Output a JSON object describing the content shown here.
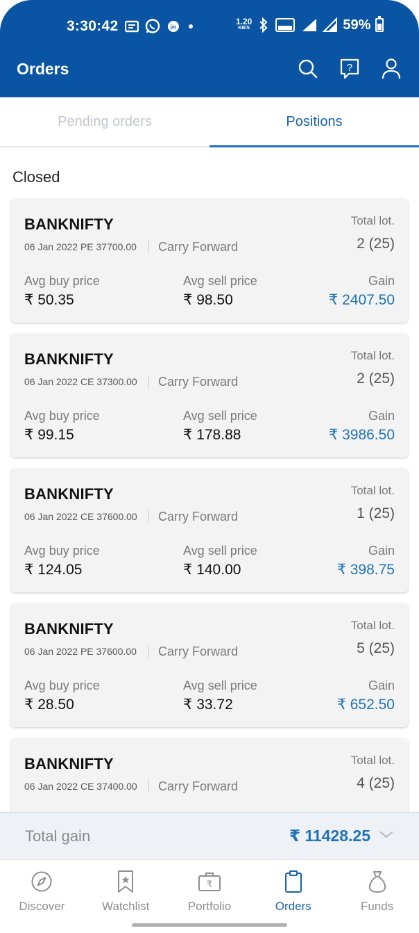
{
  "status_bar": {
    "time": "3:30:42",
    "net_speed_value": "1.20",
    "net_speed_unit": "KB/S",
    "battery": "59%"
  },
  "header": {
    "title": "Orders",
    "icons": [
      "search-icon",
      "help-chat-icon",
      "profile-icon"
    ]
  },
  "tabs": [
    {
      "label": "Pending orders",
      "active": false
    },
    {
      "label": "Positions",
      "active": true
    }
  ],
  "section_title": "Closed",
  "columns": {
    "total_lot": "Total lot.",
    "avg_buy": "Avg buy price",
    "avg_sell": "Avg sell price",
    "gain": "Gain"
  },
  "positions": [
    {
      "symbol": "BANKNIFTY",
      "contract": "06 Jan 2022 PE 37700.00",
      "product": "Carry Forward",
      "lots": "2 (25)",
      "avg_buy": "₹ 50.35",
      "avg_sell": "₹ 98.50",
      "gain": "₹ 2407.50"
    },
    {
      "symbol": "BANKNIFTY",
      "contract": "06 Jan 2022 CE 37300.00",
      "product": "Carry Forward",
      "lots": "2 (25)",
      "avg_buy": "₹ 99.15",
      "avg_sell": "₹ 178.88",
      "gain": "₹ 3986.50"
    },
    {
      "symbol": "BANKNIFTY",
      "contract": "06 Jan 2022 CE 37600.00",
      "product": "Carry Forward",
      "lots": "1 (25)",
      "avg_buy": "₹ 124.05",
      "avg_sell": "₹ 140.00",
      "gain": "₹ 398.75"
    },
    {
      "symbol": "BANKNIFTY",
      "contract": "06 Jan 2022 PE 37600.00",
      "product": "Carry Forward",
      "lots": "5 (25)",
      "avg_buy": "₹ 28.50",
      "avg_sell": "₹ 33.72",
      "gain": "₹ 652.50"
    },
    {
      "symbol": "BANKNIFTY",
      "contract": "06 Jan 2022 CE 37400.00",
      "product": "Carry Forward",
      "lots": "4 (25)",
      "avg_buy": "",
      "avg_sell": "",
      "gain": ""
    }
  ],
  "total": {
    "label": "Total gain",
    "value": "₹ 11428.25"
  },
  "bottom_nav": [
    {
      "label": "Discover",
      "icon": "compass-icon",
      "active": false
    },
    {
      "label": "Watchlist",
      "icon": "bookmark-star-icon",
      "active": false
    },
    {
      "label": "Portfolio",
      "icon": "briefcase-rupee-icon",
      "active": false
    },
    {
      "label": "Orders",
      "icon": "clipboard-icon",
      "active": true
    },
    {
      "label": "Funds",
      "icon": "money-bag-icon",
      "active": false
    }
  ],
  "colors": {
    "header_bg": "#0a55a3",
    "accent": "#1a63ad",
    "gain": "#1f73b7",
    "card_bg": "#f3f3f3"
  }
}
